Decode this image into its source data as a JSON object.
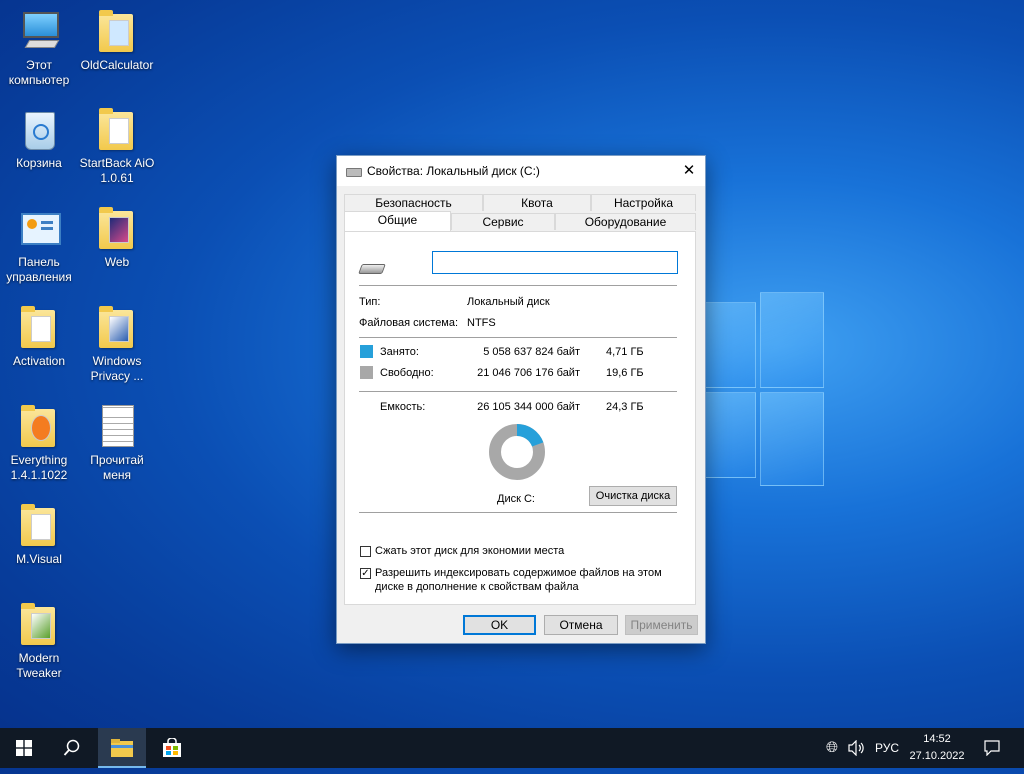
{
  "desktop": {
    "icons": [
      {
        "label": "Этот компьютер"
      },
      {
        "label": "OldCalculator"
      },
      {
        "label": "Корзина"
      },
      {
        "label": "StartBack AiO 1.0.61"
      },
      {
        "label": "Панель управления"
      },
      {
        "label": "Web"
      },
      {
        "label": "Activation"
      },
      {
        "label": "Windows Privacy ..."
      },
      {
        "label": "Everything 1.4.1.1022"
      },
      {
        "label": "Прочитай меня"
      },
      {
        "label": "M.Visual"
      },
      {
        "label": "Modern Tweaker"
      }
    ]
  },
  "dialog": {
    "title": "Свойства: Локальный диск (C:)",
    "close_glyph": "✕",
    "tabs_back": [
      "Безопасность",
      "Квота",
      "Настройка"
    ],
    "tabs_front": [
      "Общие",
      "Сервис",
      "Оборудование"
    ],
    "active_tab": "Общие",
    "volume_name_value": "",
    "type_label": "Тип:",
    "type_value": "Локальный диск",
    "fs_label": "Файловая система:",
    "fs_value": "NTFS",
    "used_label": "Занято:",
    "used_bytes": "5 058 637 824 байт",
    "used_gb": "4,71 ГБ",
    "free_label": "Свободно:",
    "free_bytes": "21 046 706 176 байт",
    "free_gb": "19,6 ГБ",
    "capacity_label": "Емкость:",
    "capacity_bytes": "26 105 344 000 байт",
    "capacity_gb": "24,3 ГБ",
    "used_fraction": 0.194,
    "used_color": "#26a0da",
    "free_color": "#a8a8a8",
    "disk_label": "Диск C:",
    "cleanup_button": "Очистка диска",
    "compress_label": "Сжать этот диск для экономии места",
    "compress_checked": false,
    "index_label_line1": "Разрешить индексировать содержимое файлов на этом",
    "index_label_line2": "диске в дополнение к свойствам файла",
    "index_checked": true,
    "ok_button": "OK",
    "cancel_button": "Отмена",
    "apply_button": "Применить"
  },
  "taskbar": {
    "language": "РУС",
    "time": "14:52",
    "date": "27.10.2022"
  }
}
